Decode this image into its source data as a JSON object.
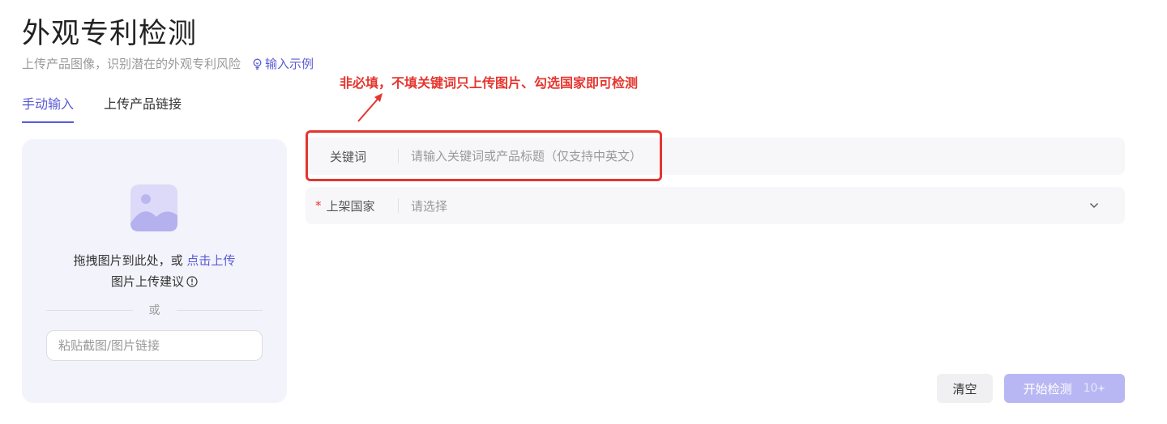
{
  "header": {
    "title": "外观专利检测",
    "subtitle": "上传产品图像，识别潜在的外观专利风险",
    "example_link": "输入示例"
  },
  "annotation": {
    "text": "非必填，不填关键词只上传图片、勾选国家即可检测",
    "color": "#e5352e"
  },
  "tabs": [
    {
      "label": "手动输入",
      "active": true
    },
    {
      "label": "上传产品链接",
      "active": false
    }
  ],
  "upload": {
    "drag_text": "拖拽图片到此处，或",
    "upload_link": "点击上传",
    "advice": "图片上传建议",
    "or": "或",
    "paste_placeholder": "粘贴截图/图片链接"
  },
  "form": {
    "keyword_label": "关键词",
    "keyword_placeholder": "请输入关键词或产品标题（仅支持中英文）",
    "country_label": "上架国家",
    "country_required_mark": "*",
    "country_placeholder": "请选择"
  },
  "buttons": {
    "clear": "清空",
    "start": "开始检测",
    "cost": "10"
  },
  "colors": {
    "accent": "#5b5bd6",
    "start_button": "#b9b7f3",
    "panel_bg": "#f3f3fb",
    "field_bg": "#f7f7fa"
  }
}
